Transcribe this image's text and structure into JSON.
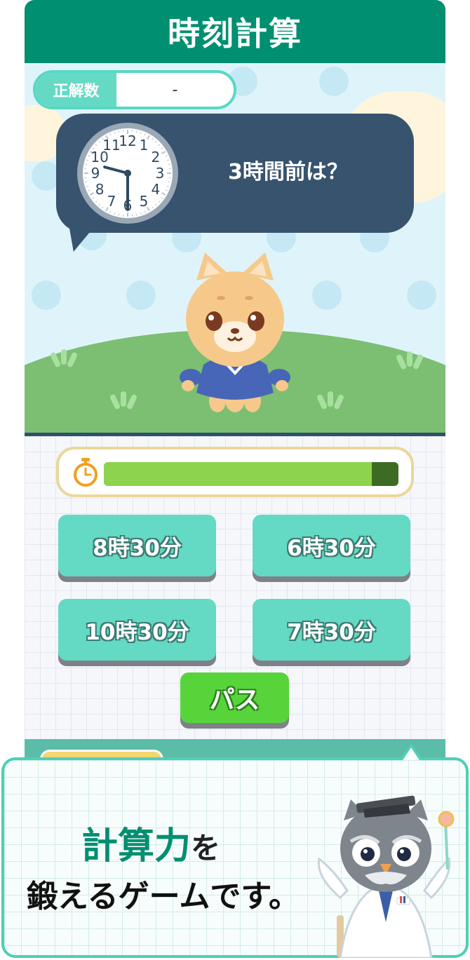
{
  "header": {
    "title": "時刻計算"
  },
  "score": {
    "label": "正解数",
    "value": "-"
  },
  "question": {
    "text": "3時間前は？",
    "clock_numbers": [
      "12",
      "1",
      "2",
      "3",
      "4",
      "5",
      "6",
      "7",
      "8",
      "9",
      "10",
      "11"
    ],
    "clock_hour": 9,
    "clock_minute": 30
  },
  "timer": {
    "remaining_fraction": 0.91
  },
  "answers": [
    {
      "label": "8時30分"
    },
    {
      "label": "6時30分"
    },
    {
      "label": "10時30分"
    },
    {
      "label": "7時30分"
    }
  ],
  "pass_button": {
    "label": "パス"
  },
  "promo": {
    "highlight": "計算力",
    "particle": "を",
    "line2": "鍛えるゲームです。"
  },
  "colors": {
    "header": "#008f70",
    "answer_button": "#64d9c4",
    "pass_button": "#57d43a",
    "timer_fill": "#8ed34e",
    "bubble": "#37536e"
  }
}
